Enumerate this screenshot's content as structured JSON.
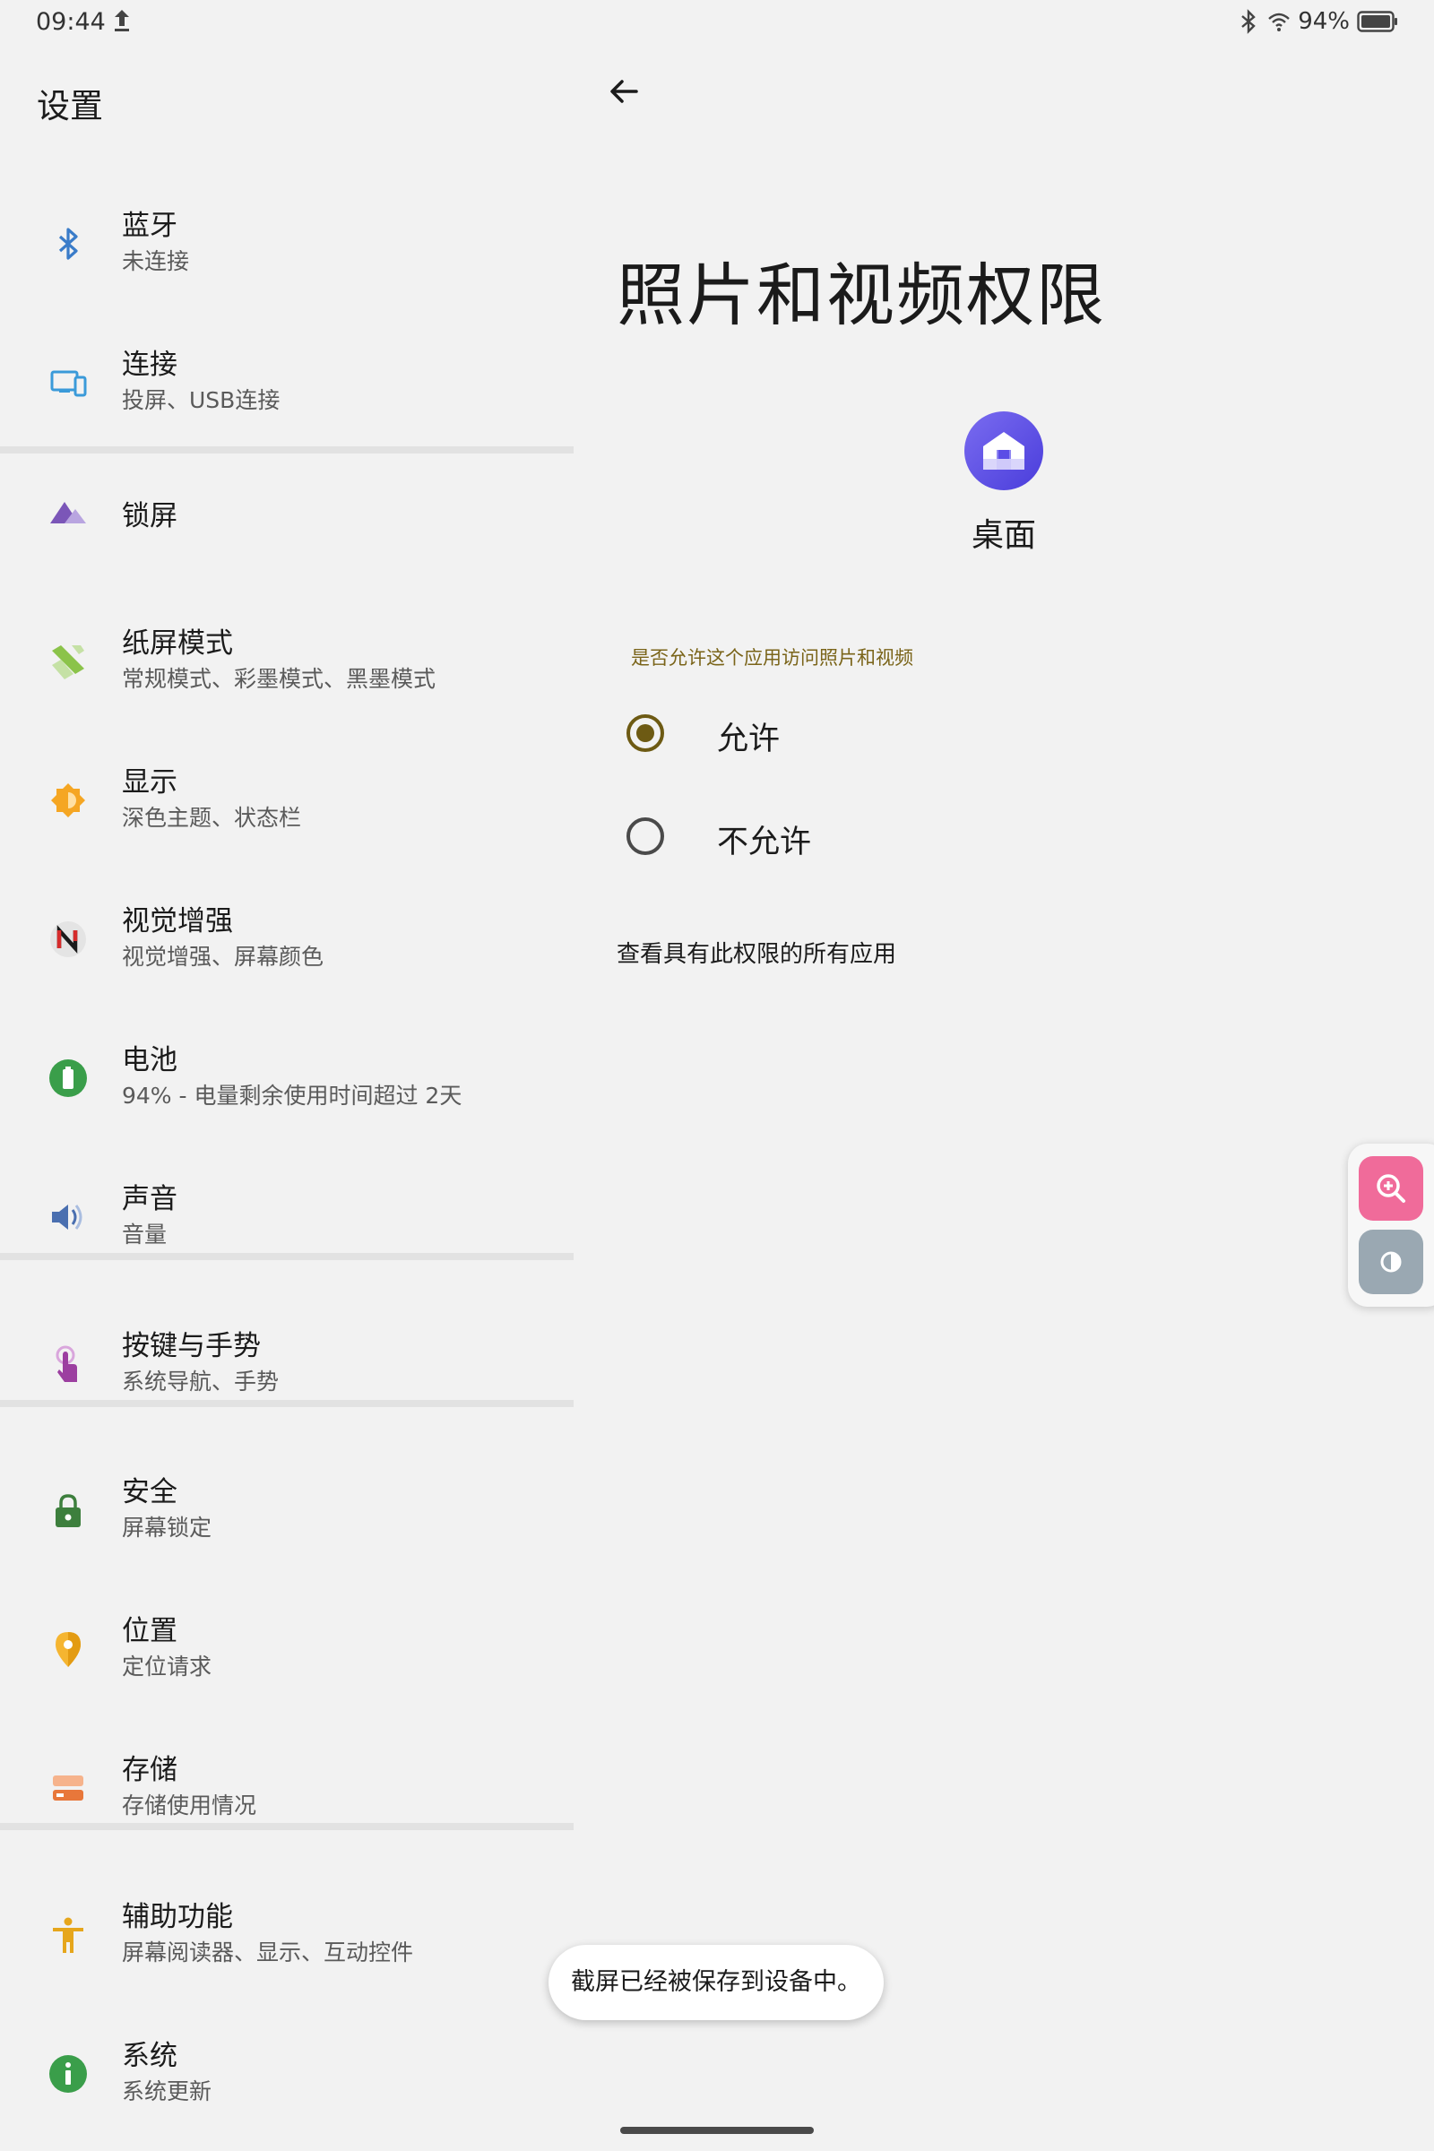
{
  "status_bar": {
    "time": "09:44",
    "battery_text": "94%",
    "icons": [
      "upload-icon",
      "bluetooth-icon",
      "wifi-icon",
      "battery-icon"
    ]
  },
  "left_pane": {
    "title": "设置",
    "items": [
      {
        "label": "蓝牙",
        "subtitle": "未连接",
        "icon": "bluetooth-icon",
        "color": "#3a7cc9"
      },
      {
        "label": "连接",
        "subtitle": "投屏、USB连接",
        "icon": "devices-icon",
        "color": "#3a9ad9"
      },
      {
        "label": "锁屏",
        "subtitle": "",
        "icon": "lockscreen-icon",
        "color": "#7b56b8"
      },
      {
        "label": "纸屏模式",
        "subtitle": "常规模式、彩墨模式、黑墨模式",
        "icon": "paper-mode-icon",
        "color": "#8bc34a"
      },
      {
        "label": "显示",
        "subtitle": "深色主题、状态栏",
        "icon": "brightness-icon",
        "color": "#f5a623"
      },
      {
        "label": "视觉增强",
        "subtitle": "视觉增强、屏幕颜色",
        "icon": "visual-enhance-icon",
        "color": "#d62b2b"
      },
      {
        "label": "电池",
        "subtitle": "94% - 电量剩余使用时间超过 2天",
        "icon": "battery-icon",
        "color": "#3a9e4a"
      },
      {
        "label": "声音",
        "subtitle": "音量",
        "icon": "volume-icon",
        "color": "#4a6fb0"
      },
      {
        "label": "按键与手势",
        "subtitle": "系统导航、手势",
        "icon": "gesture-icon",
        "color": "#9c3fa0"
      },
      {
        "label": "安全",
        "subtitle": "屏幕锁定",
        "icon": "lock-icon",
        "color": "#3d7f3d"
      },
      {
        "label": "位置",
        "subtitle": "定位请求",
        "icon": "location-icon",
        "color": "#f5b531"
      },
      {
        "label": "存储",
        "subtitle": "存储使用情况",
        "icon": "storage-icon",
        "color": "#e8773a"
      },
      {
        "label": "辅助功能",
        "subtitle": "屏幕阅读器、显示、互动控件",
        "icon": "accessibility-icon",
        "color": "#e6a61c"
      },
      {
        "label": "系统",
        "subtitle": "系统更新",
        "icon": "info-icon",
        "color": "#3a9e4a"
      }
    ]
  },
  "detail": {
    "title": "照片和视频权限",
    "app_name": "桌面",
    "question": "是否允许这个应用访问照片和视频",
    "options": [
      {
        "label": "允许",
        "selected": true
      },
      {
        "label": "不允许",
        "selected": false
      }
    ],
    "see_all": "查看具有此权限的所有应用"
  },
  "floating_tools": [
    "zoom-in-icon",
    "contrast-icon"
  ],
  "toast": "截屏已经被保存到设备中。",
  "colors": {
    "accent": "#6d5a13",
    "question_text": "#7a6419",
    "zoom_button": "#f06b9a",
    "contrast_button": "#9aa8b2",
    "app_icon": "#5b4de6"
  }
}
